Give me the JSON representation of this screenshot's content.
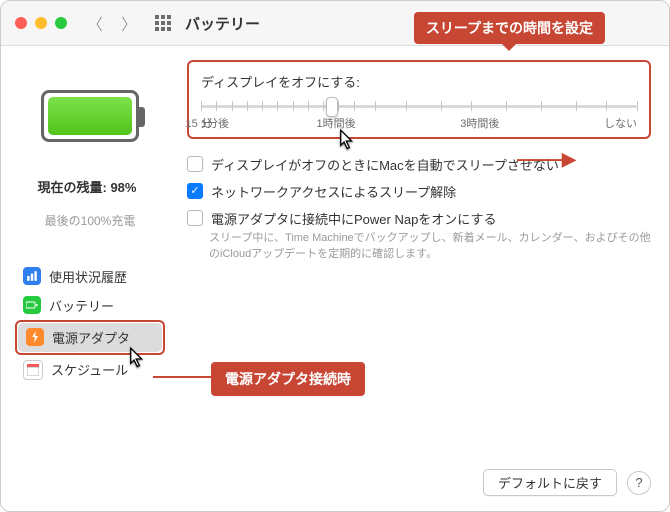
{
  "window": {
    "title": "バッテリー"
  },
  "status": {
    "main": "現在の残量: 98%",
    "sub": "最後の100%充電"
  },
  "sidebar": {
    "items": [
      {
        "label": "使用状況履歴"
      },
      {
        "label": "バッテリー"
      },
      {
        "label": "電源アダプタ"
      },
      {
        "label": "スケジュール"
      }
    ]
  },
  "slider": {
    "title": "ディスプレイをオフにする:",
    "labels": [
      "1分後",
      "15 分",
      "1時間後",
      "3時間後",
      "しない"
    ]
  },
  "checks": {
    "c0": "ディスプレイがオフのときにMacを自動でスリープさせない",
    "c1": "ネットワークアクセスによるスリープ解除",
    "c2": "電源アダプタに接続中にPower Napをオンにする",
    "c2desc": "スリープ中に、Time Machineでバックアップし、新着メール、カレンダー、およびその他のiCloudアップデートを定期的に確認します。"
  },
  "footer": {
    "reset": "デフォルトに戻す"
  },
  "annot": {
    "slider": "スリープまでの時間を設定",
    "sidebar": "電源アダプタ接続時"
  }
}
